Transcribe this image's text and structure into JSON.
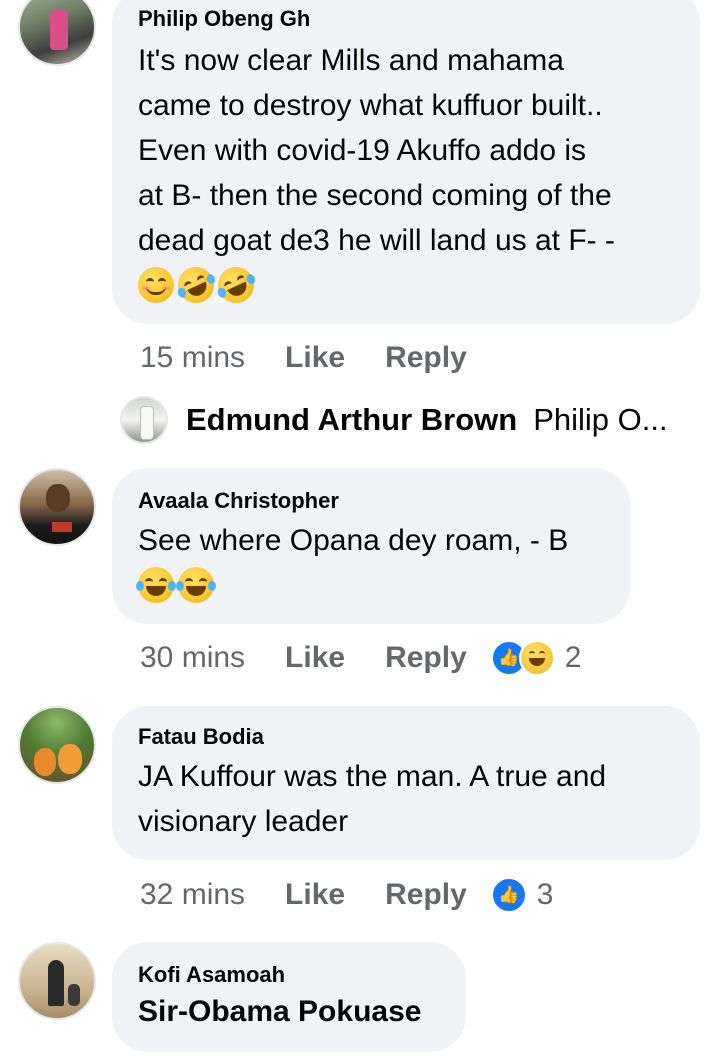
{
  "comments": [
    {
      "author": "Philip Obeng Gh",
      "text": "It's now clear Mills and mahama\ncame to destroy what kuffuor built..\nEven with covid-19 Akuffo addo is\nat B- then the second coming of the\ndead goat de3 he will land us at F- -",
      "emojis": [
        "smiling-face-emoji",
        "rolling-laughing-emoji",
        "rolling-laughing-emoji"
      ],
      "time": "15 mins",
      "like_label": "Like",
      "reply_label": "Reply"
    },
    {
      "author": "Avaala Christopher",
      "text": "See where Opana dey roam, - B",
      "emojis": [
        "tears-of-joy-emoji",
        "tears-of-joy-emoji"
      ],
      "time": "30 mins",
      "like_label": "Like",
      "reply_label": "Reply",
      "reactions": [
        "like-reaction-icon",
        "haha-reaction-icon"
      ],
      "reaction_count": "2"
    },
    {
      "author": "Fatau Bodia",
      "text": "JA Kuffour was the man. A true and\nvisionary leader",
      "time": "32 mins",
      "like_label": "Like",
      "reply_label": "Reply",
      "reactions": [
        "like-reaction-icon"
      ],
      "reaction_count": "3"
    },
    {
      "author": "Kofi Asamoah",
      "text": "Sir-Obama Pokuase"
    }
  ],
  "reply_preview": {
    "name": "Edmund Arthur Brown",
    "text": "Philip O..."
  },
  "colors": {
    "bubble": "#f0f2f5",
    "meta_text": "#65676b",
    "like_blue": "#1877f2"
  }
}
